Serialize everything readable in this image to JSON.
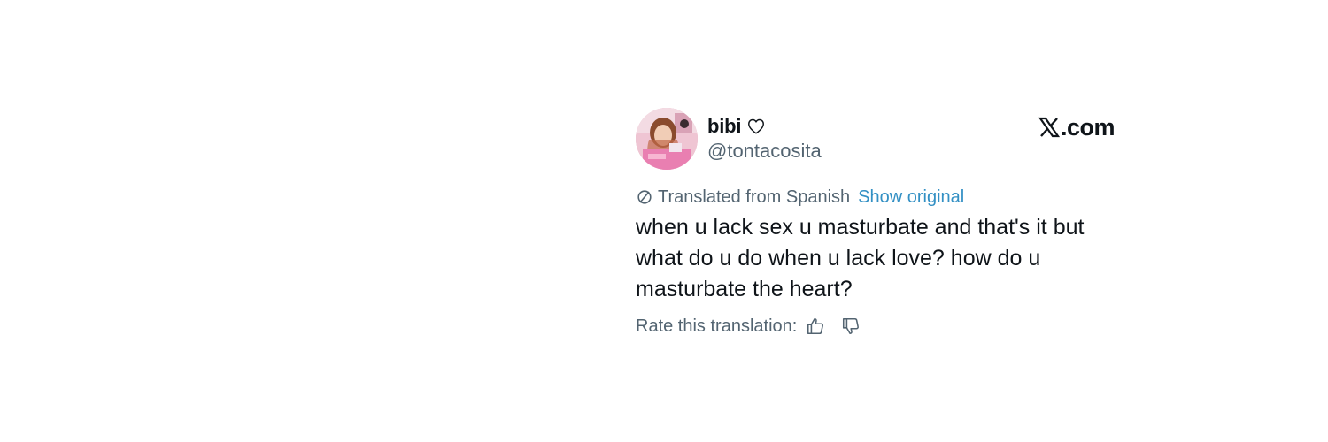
{
  "tweet": {
    "display_name": "bibi",
    "name_icon": "heart-outline-icon",
    "handle": "@tontacosita",
    "avatar_icon": "profile-photo",
    "brand": ".com",
    "brand_icon": "x-logo-icon",
    "translation": {
      "icon": "translate-icon",
      "label": "Translated from Spanish",
      "show_original_label": "Show original"
    },
    "text_lines": [
      "when u lack sex u masturbate and that's it but",
      "what do u do when u lack love? how do u",
      "masturbate the heart?"
    ],
    "rating": {
      "label": "Rate this translation:",
      "thumbs_up_icon": "thumbs-up-icon",
      "thumbs_down_icon": "thumbs-down-icon"
    }
  },
  "colors": {
    "text_primary": "#0f1419",
    "text_secondary": "#536471",
    "link": "#3390c4",
    "background": "#ffffff"
  }
}
